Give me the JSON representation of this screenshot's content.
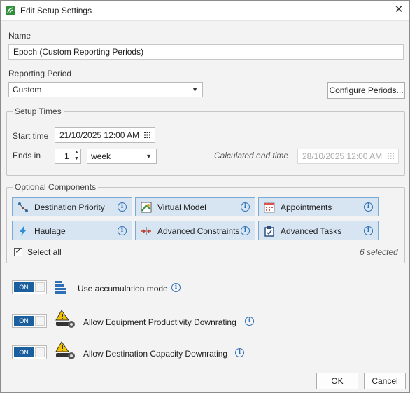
{
  "window": {
    "title": "Edit Setup Settings",
    "close_glyph": "✕"
  },
  "name": {
    "label": "Name",
    "value": "Epoch (Custom Reporting Periods)"
  },
  "reporting": {
    "label": "Reporting Period",
    "value": "Custom",
    "configure_label": "Configure Periods..."
  },
  "setup_times": {
    "title": "Setup Times",
    "start_label": "Start time",
    "start_value": "21/10/2025 12:00 AM",
    "ends_label": "Ends in",
    "ends_value": "1",
    "unit_value": "week",
    "calc_label": "Calculated end time",
    "calc_value": "28/10/2025 12:00 AM"
  },
  "components": {
    "title": "Optional Components",
    "items": [
      {
        "label": "Destination Priority",
        "icon": "destination-priority-icon"
      },
      {
        "label": "Virtual Model",
        "icon": "virtual-model-icon"
      },
      {
        "label": "Appointments",
        "icon": "calendar-icon"
      },
      {
        "label": "Haulage",
        "icon": "lightning-icon"
      },
      {
        "label": "Advanced Constraints",
        "icon": "constraints-icon"
      },
      {
        "label": "Advanced Tasks",
        "icon": "tasks-icon"
      }
    ],
    "select_all_label": "Select all",
    "selected_count": "6 selected"
  },
  "options": [
    {
      "toggle": "ON",
      "label": "Use accumulation mode",
      "icon": "accumulation-icon"
    },
    {
      "toggle": "ON",
      "label": "Allow Equipment Productivity Downrating",
      "icon": "excavator-icon"
    },
    {
      "toggle": "ON",
      "label": "Allow Destination Capacity Downrating",
      "icon": "excavator-icon"
    }
  ],
  "footer": {
    "ok_label": "OK",
    "cancel_label": "Cancel"
  },
  "colors": {
    "accent": "#1c5f9e",
    "component_bg": "#d7e5f3",
    "component_border": "#7aaad6",
    "app_icon": "#2f8f3a"
  }
}
